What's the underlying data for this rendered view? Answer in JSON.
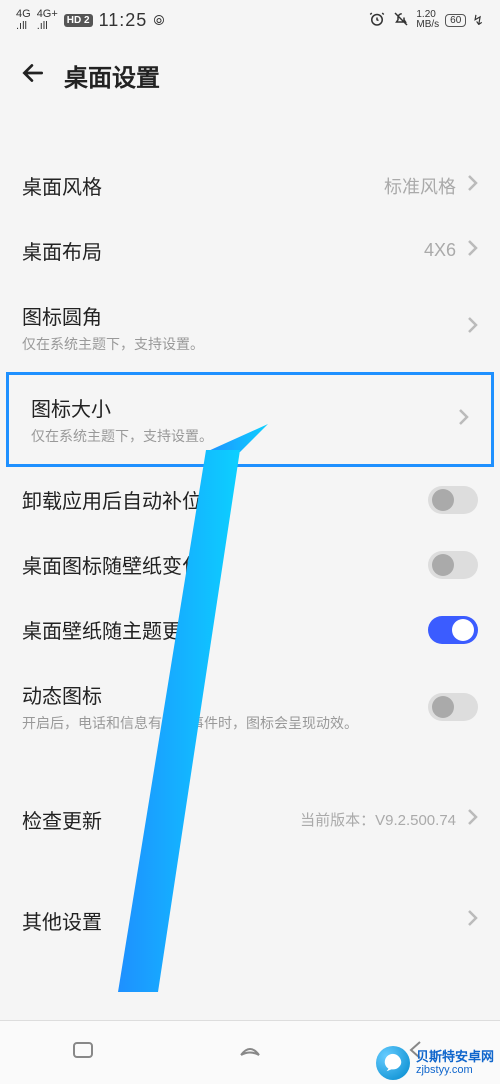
{
  "status": {
    "sig1": "4G",
    "sig2": "4G+",
    "hd": "HD 2",
    "time": "11:25",
    "nfc": "⦾",
    "alarm_icon": "alarm",
    "mute_icon": "bell-off",
    "net_speed": "1.20",
    "net_unit": "MB/s",
    "battery": "60",
    "charging": "↯"
  },
  "header": {
    "title": "桌面设置"
  },
  "rows": {
    "style": {
      "label": "桌面风格",
      "value": "标准风格"
    },
    "layout": {
      "label": "桌面布局",
      "value": "4X6"
    },
    "corner": {
      "label": "图标圆角",
      "sub": "仅在系统主题下，支持设置。"
    },
    "size": {
      "label": "图标大小",
      "sub": "仅在系统主题下，支持设置。"
    },
    "autofill": {
      "label": "卸载应用后自动补位",
      "on": false
    },
    "iconwall": {
      "label": "桌面图标随壁纸变化",
      "on": false
    },
    "wallpapertheme": {
      "label": "桌面壁纸随主题更换",
      "on": true
    },
    "dynamic": {
      "label": "动态图标",
      "sub": "开启后，电话和信息有未读事件时，图标会呈现动效。",
      "on": false
    },
    "update": {
      "label": "检查更新",
      "value": "当前版本：V9.2.500.74"
    },
    "other": {
      "label": "其他设置"
    }
  },
  "watermark": {
    "brand": "贝斯特安卓网",
    "url": "zjbstyy.com"
  }
}
